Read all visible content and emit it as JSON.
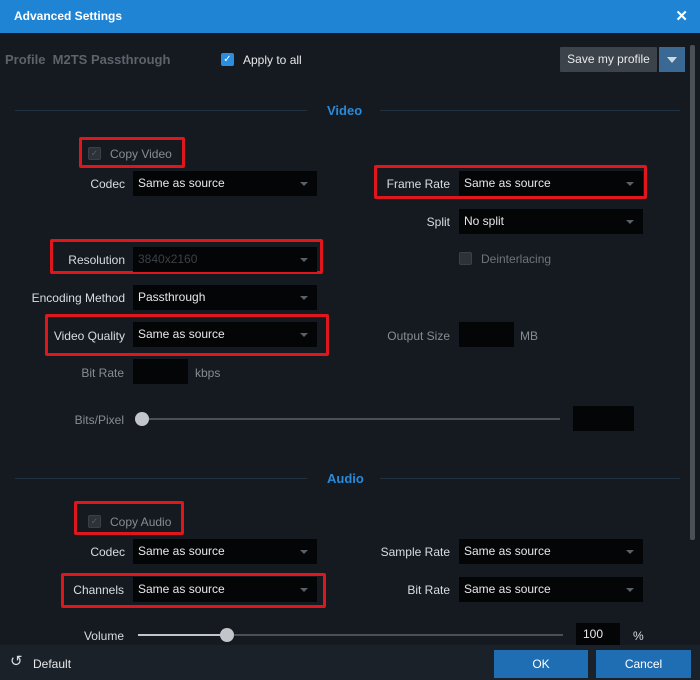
{
  "window": {
    "title": "Advanced Settings",
    "close_icon": "close-icon"
  },
  "profile": {
    "label": "Profile  M2TS Passthrough",
    "apply_to_all": {
      "label": "Apply to all",
      "checked": true
    },
    "save_button": "Save my profile"
  },
  "video": {
    "section_title": "Video",
    "copy_video": {
      "label": "Copy Video",
      "checked": true,
      "enabled": false
    },
    "codec": {
      "label": "Codec",
      "value": "Same as source"
    },
    "frame_rate": {
      "label": "Frame Rate",
      "value": "Same as source"
    },
    "split": {
      "label": "Split",
      "value": "No split"
    },
    "resolution": {
      "label": "Resolution",
      "value": "3840x2160"
    },
    "deinterlacing": {
      "label": "Deinterlacing",
      "checked": false
    },
    "encoding_method": {
      "label": "Encoding Method",
      "value": "Passthrough"
    },
    "video_quality": {
      "label": "Video Quality",
      "value": "Same as source"
    },
    "output_size": {
      "label": "Output Size",
      "unit": "MB",
      "value": ""
    },
    "bit_rate": {
      "label": "Bit Rate",
      "unit": "kbps",
      "value": ""
    },
    "bits_pixel": {
      "label": "Bits/Pixel",
      "value": "",
      "slider_level": 0
    }
  },
  "audio": {
    "section_title": "Audio",
    "copy_audio": {
      "label": "Copy Audio",
      "checked": true,
      "enabled": false
    },
    "codec": {
      "label": "Codec",
      "value": "Same as source"
    },
    "sample_rate": {
      "label": "Sample Rate",
      "value": "Same as source"
    },
    "channels": {
      "label": "Channels",
      "value": "Same as source"
    },
    "bit_rate": {
      "label": "Bit Rate",
      "value": "Same as source"
    },
    "volume": {
      "label": "Volume",
      "value": "100",
      "unit": "%",
      "slider_level": 0.21
    }
  },
  "footer": {
    "default_label": "Default",
    "ok_label": "OK",
    "cancel_label": "Cancel"
  },
  "colors": {
    "accent": "#1f84d4",
    "highlight": "#e0161d",
    "background": "#151a21"
  }
}
